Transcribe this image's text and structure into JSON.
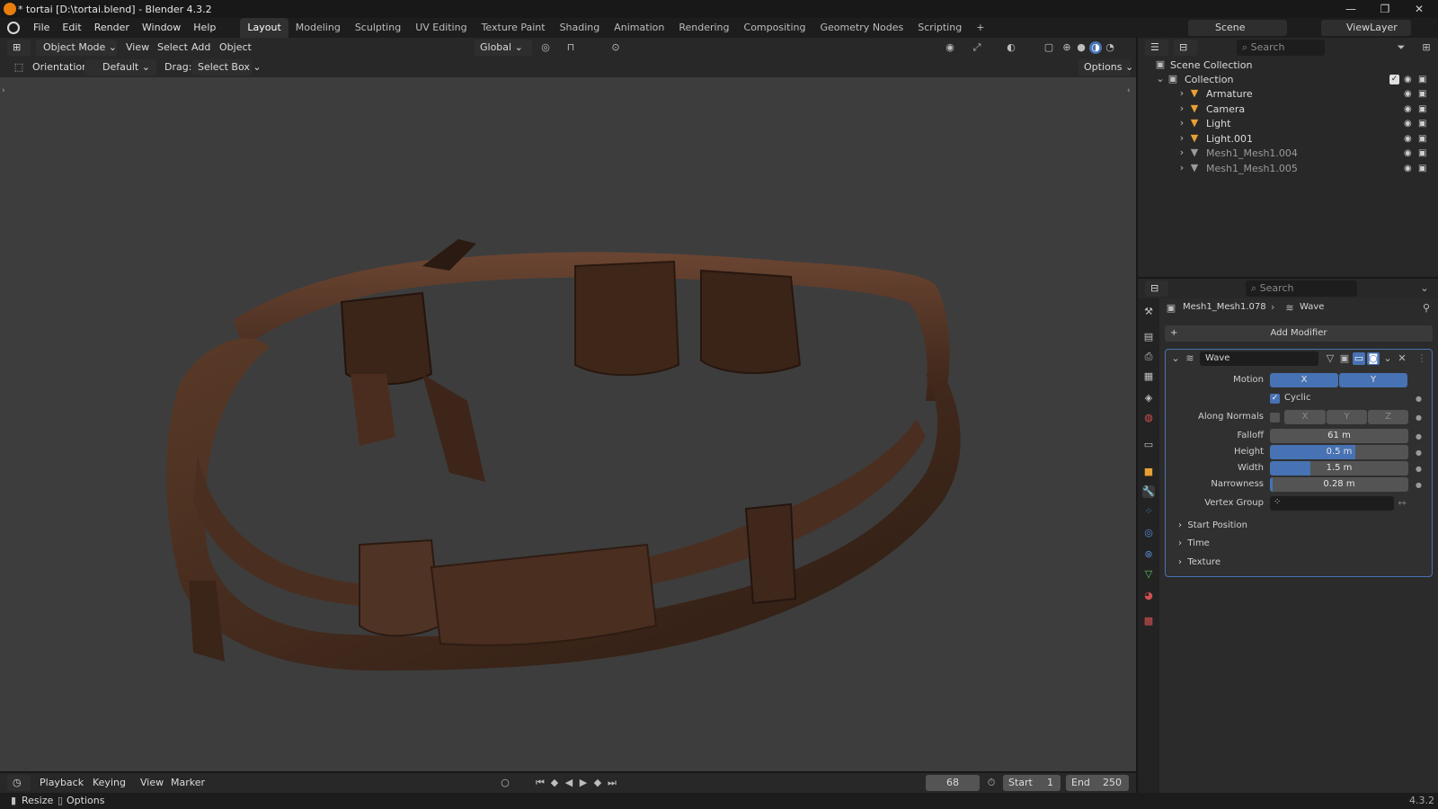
{
  "window": {
    "title": "* tortai [D:\\tortai.blend] - Blender 4.3.2",
    "minimize": "—",
    "maximize": "❐",
    "close": "✕"
  },
  "menu": {
    "items": [
      "File",
      "Edit",
      "Render",
      "Window",
      "Help"
    ]
  },
  "workspaces": {
    "tabs": [
      "Layout",
      "Modeling",
      "Sculpting",
      "UV Editing",
      "Texture Paint",
      "Shading",
      "Animation",
      "Rendering",
      "Compositing",
      "Geometry Nodes",
      "Scripting"
    ],
    "active": "Layout",
    "add": "+"
  },
  "topright": {
    "scene": "Scene",
    "viewlayer": "ViewLayer"
  },
  "viewport_header": {
    "mode": "Object Mode",
    "view": "View",
    "select": "Select",
    "add": "Add",
    "object": "Object",
    "transform": "Global"
  },
  "tool_header": {
    "orientation_label": "Orientation:",
    "orientation_value": "Default",
    "drag_label": "Drag:",
    "drag_value": "Select Box",
    "options": "Options"
  },
  "outliner": {
    "search_placeholder": "Search",
    "scene_collection": "Scene Collection",
    "collection": "Collection",
    "items": [
      {
        "name": "Armature",
        "color": "#e8a035"
      },
      {
        "name": "Camera",
        "color": "#e8a035"
      },
      {
        "name": "Light",
        "color": "#e8a035"
      },
      {
        "name": "Light.001",
        "color": "#e8a035"
      },
      {
        "name": "Mesh1_Mesh1.004",
        "color": "#9a9a9a"
      },
      {
        "name": "Mesh1_Mesh1.005",
        "color": "#9a9a9a"
      }
    ]
  },
  "properties": {
    "search_placeholder": "Search",
    "breadcrumb_object": "Mesh1_Mesh1.078",
    "breadcrumb_modifier": "Wave",
    "add_modifier": "Add Modifier",
    "modifier_name": "Wave",
    "motion_label": "Motion",
    "motion_x": "X",
    "motion_y": "Y",
    "cyclic_label": "Cyclic",
    "along_normals_label": "Along Normals",
    "normals_x": "X",
    "normals_y": "Y",
    "normals_z": "Z",
    "falloff_label": "Falloff",
    "falloff_value": "61 m",
    "height_label": "Height",
    "height_value": "0.5 m",
    "height_fill": 0.62,
    "width_label": "Width",
    "width_value": "1.5 m",
    "width_fill": 0.29,
    "narrowness_label": "Narrowness",
    "narrowness_value": "0.28 m",
    "narrowness_fill": 0.02,
    "vertex_group_label": "Vertex Group",
    "start_position": "Start Position",
    "time": "Time",
    "texture": "Texture"
  },
  "timeline": {
    "playback": "Playback",
    "keying": "Keying",
    "view": "View",
    "marker": "Marker",
    "current_frame": "68",
    "start_label": "Start",
    "start_value": "1",
    "end_label": "End",
    "end_value": "250"
  },
  "statusbar": {
    "resize": "Resize",
    "options": "Options",
    "version": "4.3.2"
  },
  "colors": {
    "accent": "#4772b3",
    "object_orange": "#e8a035",
    "viewport_bg": "#3d3d3d"
  }
}
